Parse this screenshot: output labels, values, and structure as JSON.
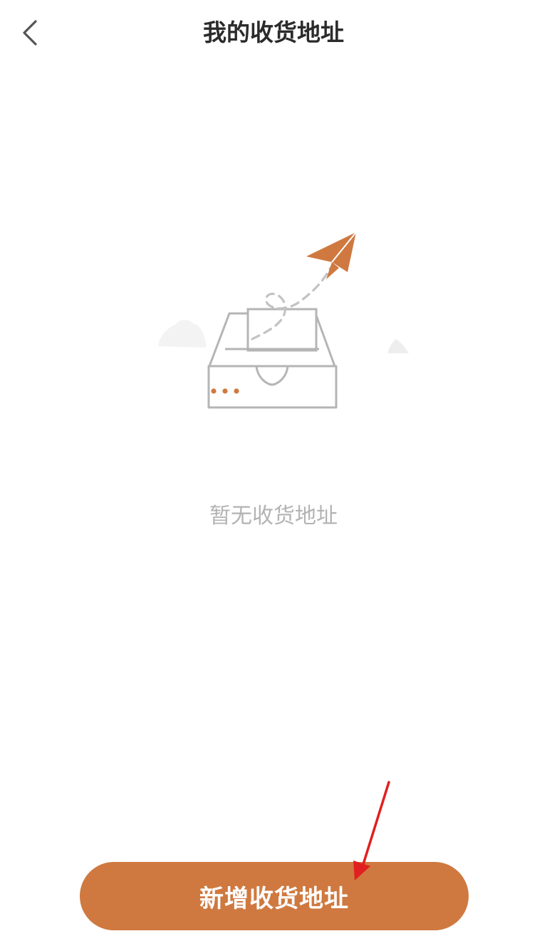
{
  "header": {
    "title": "我的收货地址",
    "back_icon": "chevron-left-icon"
  },
  "empty_state": {
    "illustration": "empty-inbox-paper-plane",
    "message": "暂无收货地址"
  },
  "footer": {
    "add_button_label": "新增收货地址"
  },
  "colors": {
    "accent": "#cf7940",
    "outline_gray": "#b5b5b5",
    "empty_text": "#b3b3b3",
    "annotation_red": "#e02020"
  }
}
